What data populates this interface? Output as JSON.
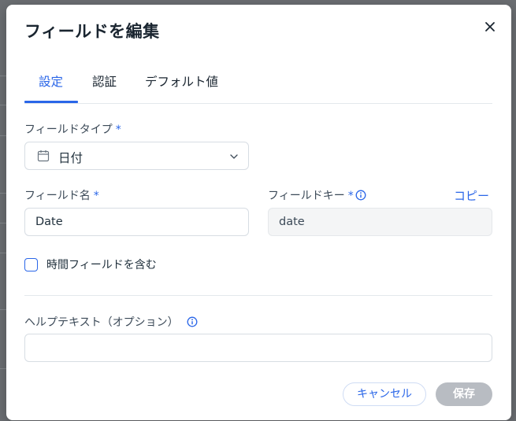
{
  "dialog": {
    "title": "フィールドを編集",
    "close_icon": "close-icon"
  },
  "tabs": [
    {
      "label": "設定",
      "active": true
    },
    {
      "label": "認証",
      "active": false
    },
    {
      "label": "デフォルト値",
      "active": false
    }
  ],
  "field_type": {
    "label": "フィールドタイプ",
    "required_mark": "*",
    "value": "日付",
    "icon": "calendar-icon"
  },
  "field_name": {
    "label": "フィールド名",
    "required_mark": "*",
    "value": "Date"
  },
  "field_key": {
    "label": "フィールドキー",
    "required_mark": "*",
    "value": "date",
    "copy_label": "コピー",
    "icon": "info-icon"
  },
  "include_time": {
    "label": "時間フィールドを含む",
    "checked": false
  },
  "help_text": {
    "label": "ヘルプテキスト（オプション）",
    "value": "",
    "icon": "info-icon"
  },
  "actions": {
    "cancel_label": "キャンセル",
    "save_label": "保存"
  },
  "colors": {
    "accent": "#2a66e8",
    "save_disabled": "#b8bcc2"
  }
}
